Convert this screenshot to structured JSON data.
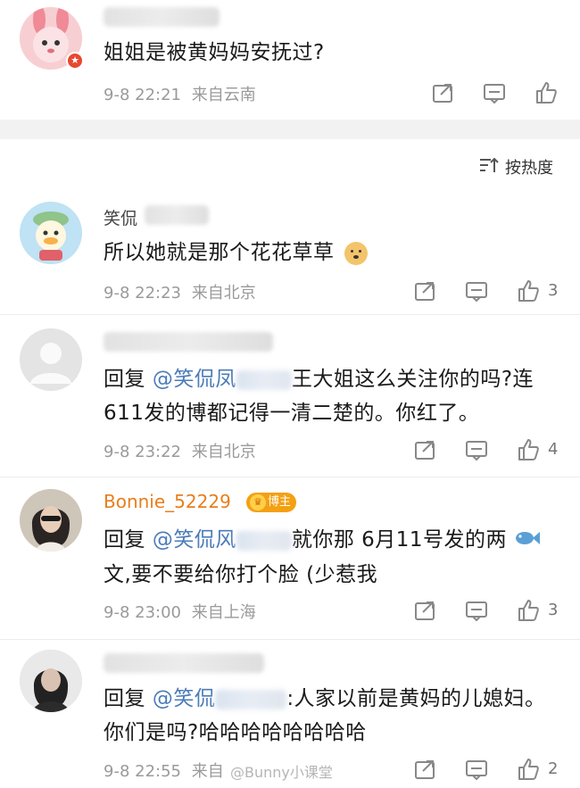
{
  "top_comment": {
    "text": "姐姐是被黄妈妈安抚过?",
    "time": "9-8 22:21",
    "source": "来自云南"
  },
  "sort": {
    "label": "按热度",
    "icon": "sort-hot-icon"
  },
  "comments": [
    {
      "name_visible": "笑侃",
      "text": "所以她就是那个花花草草",
      "emoji": "doge-emoji",
      "time": "9-8 22:23",
      "source": "来自北京",
      "likes": "3"
    },
    {
      "reply_prefix": "回复 ",
      "mention": "@笑侃凤",
      "text_line1": "王大姐这么关注你的吗?连",
      "text_line2": "611发的博都记得一清二楚的。你红了。",
      "time": "9-8 23:22",
      "source": "来自北京",
      "likes": "4"
    },
    {
      "name": "Bonnie_52229",
      "badge": "博主",
      "reply_prefix": "回复 ",
      "mention": "@笑侃风",
      "text_line1": "就你那 6月11号发的两",
      "text_line2": "文,要不要给你打个脸 (少惹我",
      "emoji": "fish-emoji",
      "time": "9-8 23:00",
      "source": "来自上海",
      "likes": "3"
    },
    {
      "reply_prefix": "回复 ",
      "mention": "@笑侃",
      "text_line1": ":人家以前是黄妈的儿媳妇。",
      "text_line2": "你们是吗?哈哈哈哈哈哈哈哈",
      "time": "9-8 22:55",
      "source": "来自",
      "likes": "2"
    }
  ],
  "watermark": "@Bunny小课堂",
  "colors": {
    "accent_link": "#4b7bb8",
    "bonnie_orange": "#e87e1b",
    "badge": "#f4a012"
  }
}
